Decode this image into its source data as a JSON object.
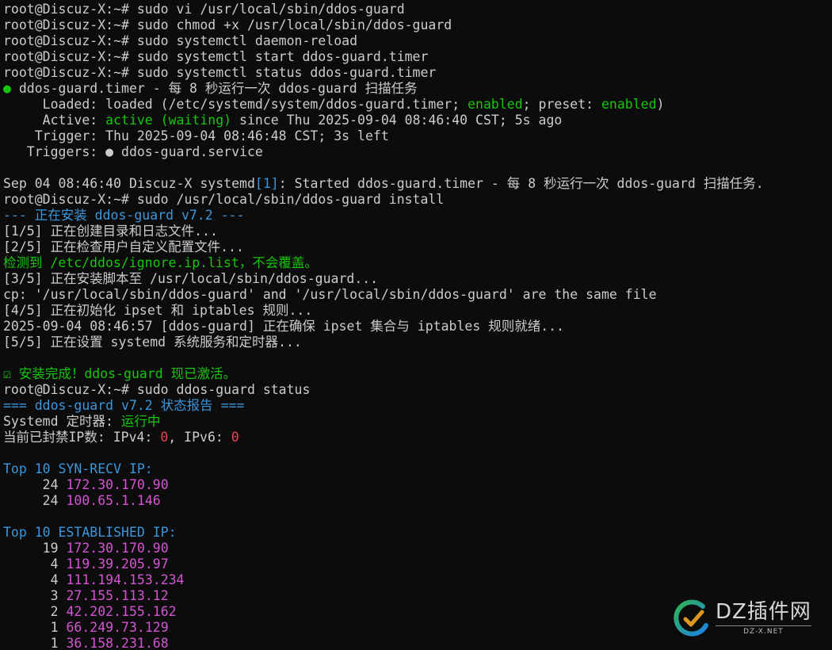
{
  "colors": {
    "default": "#cccccc",
    "green": "#16c60c",
    "cyan": "#3a96dd",
    "magenta": "#d454d4",
    "red": "#e74856",
    "background": "#0c0c0c"
  },
  "lines": [
    {
      "segments": [
        {
          "text": "root@Discuz-X:~# sudo vi /usr/local/sbin/ddos-guard",
          "color": "default"
        }
      ]
    },
    {
      "segments": [
        {
          "text": "root@Discuz-X:~# sudo chmod +x /usr/local/sbin/ddos-guard",
          "color": "default"
        }
      ]
    },
    {
      "segments": [
        {
          "text": "root@Discuz-X:~# sudo systemctl daemon-reload",
          "color": "default"
        }
      ]
    },
    {
      "segments": [
        {
          "text": "root@Discuz-X:~# sudo systemctl start ddos-guard.timer",
          "color": "default"
        }
      ]
    },
    {
      "segments": [
        {
          "text": "root@Discuz-X:~# sudo systemctl status ddos-guard.timer",
          "color": "default"
        }
      ]
    },
    {
      "segments": [
        {
          "text": "●",
          "color": "green"
        },
        {
          "text": " ddos-guard.timer - 每 8 秒运行一次 ddos-guard 扫描任务",
          "color": "default"
        }
      ]
    },
    {
      "segments": [
        {
          "text": "     Loaded: loaded (/etc/systemd/system/ddos-guard.timer; ",
          "color": "default"
        },
        {
          "text": "enabled",
          "color": "green"
        },
        {
          "text": "; preset: ",
          "color": "default"
        },
        {
          "text": "enabled",
          "color": "green"
        },
        {
          "text": ")",
          "color": "default"
        }
      ]
    },
    {
      "segments": [
        {
          "text": "     Active: ",
          "color": "default"
        },
        {
          "text": "active (waiting)",
          "color": "green"
        },
        {
          "text": " since Thu 2025-09-04 08:46:40 CST; 5s ago",
          "color": "default"
        }
      ]
    },
    {
      "segments": [
        {
          "text": "    Trigger: Thu 2025-09-04 08:46:48 CST; 3s left",
          "color": "default"
        }
      ]
    },
    {
      "segments": [
        {
          "text": "   Triggers: ● ddos-guard.service",
          "color": "default"
        }
      ]
    },
    {
      "segments": [
        {
          "text": "",
          "color": "default"
        }
      ]
    },
    {
      "segments": [
        {
          "text": "Sep 04 08:46:40 Discuz-X systemd",
          "color": "default"
        },
        {
          "text": "[1]",
          "color": "cyan"
        },
        {
          "text": ": Started ddos-guard.timer - 每 8 秒运行一次 ddos-guard 扫描任务.",
          "color": "default"
        }
      ]
    },
    {
      "segments": [
        {
          "text": "root@Discuz-X:~# sudo /usr/local/sbin/ddos-guard install",
          "color": "default"
        }
      ]
    },
    {
      "segments": [
        {
          "text": "--- 正在安装 ddos-guard v7.2 ---",
          "color": "cyan"
        }
      ]
    },
    {
      "segments": [
        {
          "text": "[1/5] 正在创建目录和日志文件...",
          "color": "default"
        }
      ]
    },
    {
      "segments": [
        {
          "text": "[2/5] 正在检查用户自定义配置文件...",
          "color": "default"
        }
      ]
    },
    {
      "segments": [
        {
          "text": "检测到 /etc/ddos/ignore.ip.list，不会覆盖。",
          "color": "green"
        }
      ]
    },
    {
      "segments": [
        {
          "text": "[3/5] 正在安装脚本至 /usr/local/sbin/ddos-guard...",
          "color": "default"
        }
      ]
    },
    {
      "segments": [
        {
          "text": "cp: '/usr/local/sbin/ddos-guard' and '/usr/local/sbin/ddos-guard' are the same file",
          "color": "default"
        }
      ]
    },
    {
      "segments": [
        {
          "text": "[4/5] 正在初始化 ipset 和 iptables 规则...",
          "color": "default"
        }
      ]
    },
    {
      "segments": [
        {
          "text": "2025-09-04 08:46:57 [ddos-guard] 正在确保 ipset 集合与 iptables 规则就绪...",
          "color": "default"
        }
      ]
    },
    {
      "segments": [
        {
          "text": "[5/5] 正在设置 systemd 系统服务和定时器...",
          "color": "default"
        }
      ]
    },
    {
      "segments": [
        {
          "text": "",
          "color": "default"
        }
      ]
    },
    {
      "segments": [
        {
          "text": "☑ 安装完成！ddos-guard 现已激活。",
          "color": "green"
        }
      ]
    },
    {
      "segments": [
        {
          "text": "root@Discuz-X:~# sudo ddos-guard status",
          "color": "default"
        }
      ]
    },
    {
      "segments": [
        {
          "text": "=== ddos-guard v7.2 状态报告 ===",
          "color": "cyan"
        }
      ]
    },
    {
      "segments": [
        {
          "text": "Systemd 定时器: ",
          "color": "default"
        },
        {
          "text": "运行中",
          "color": "green"
        }
      ]
    },
    {
      "segments": [
        {
          "text": "当前已封禁IP数: IPv4: ",
          "color": "default"
        },
        {
          "text": "0",
          "color": "red"
        },
        {
          "text": ", IPv6: ",
          "color": "default"
        },
        {
          "text": "0",
          "color": "red"
        }
      ]
    },
    {
      "segments": [
        {
          "text": "",
          "color": "default"
        }
      ]
    },
    {
      "segments": [
        {
          "text": "Top 10 SYN-RECV IP:",
          "color": "cyan"
        }
      ]
    },
    {
      "segments": [
        {
          "text": "     24 ",
          "color": "default"
        },
        {
          "text": "172.30.170.90",
          "color": "magenta"
        }
      ]
    },
    {
      "segments": [
        {
          "text": "     24 ",
          "color": "default"
        },
        {
          "text": "100.65.1.146",
          "color": "magenta"
        }
      ]
    },
    {
      "segments": [
        {
          "text": "",
          "color": "default"
        }
      ]
    },
    {
      "segments": [
        {
          "text": "Top 10 ESTABLISHED IP:",
          "color": "cyan"
        }
      ]
    },
    {
      "segments": [
        {
          "text": "     19 ",
          "color": "default"
        },
        {
          "text": "172.30.170.90",
          "color": "magenta"
        }
      ]
    },
    {
      "segments": [
        {
          "text": "      4 ",
          "color": "default"
        },
        {
          "text": "119.39.205.97",
          "color": "magenta"
        }
      ]
    },
    {
      "segments": [
        {
          "text": "      4 ",
          "color": "default"
        },
        {
          "text": "111.194.153.234",
          "color": "magenta"
        }
      ]
    },
    {
      "segments": [
        {
          "text": "      3 ",
          "color": "default"
        },
        {
          "text": "27.155.113.12",
          "color": "magenta"
        }
      ]
    },
    {
      "segments": [
        {
          "text": "      2 ",
          "color": "default"
        },
        {
          "text": "42.202.155.162",
          "color": "magenta"
        }
      ]
    },
    {
      "segments": [
        {
          "text": "      1 ",
          "color": "default"
        },
        {
          "text": "66.249.73.129",
          "color": "magenta"
        }
      ]
    },
    {
      "segments": [
        {
          "text": "      1 ",
          "color": "default"
        },
        {
          "text": "36.158.231.68",
          "color": "magenta"
        }
      ]
    }
  ],
  "watermark": {
    "title": "DZ插件网",
    "subtitle": "DZ-X.NET",
    "logo_icon": "dz-logo-icon"
  }
}
